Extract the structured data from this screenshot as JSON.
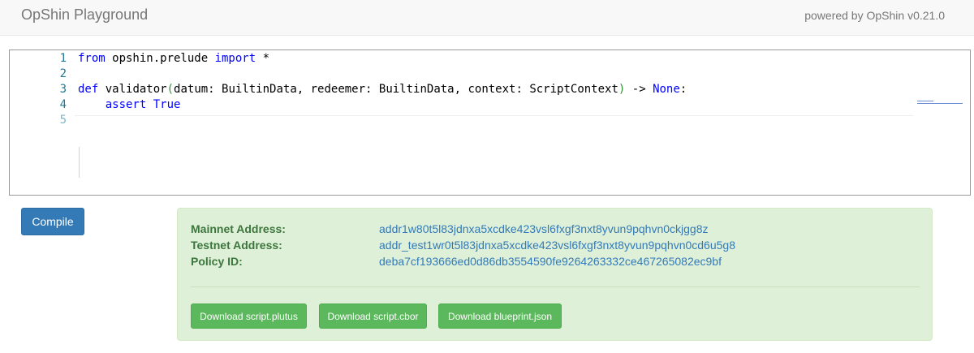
{
  "header": {
    "brand": "OpShin Playground",
    "powered_by": "powered by OpShin v0.21.0"
  },
  "editor": {
    "lines": [
      {
        "number": "1",
        "tokens": [
          {
            "t": "from",
            "k": "kw"
          },
          {
            "t": " opshin.prelude ",
            "k": ""
          },
          {
            "t": "import",
            "k": "kw"
          },
          {
            "t": " *",
            "k": ""
          }
        ]
      },
      {
        "number": "2",
        "tokens": []
      },
      {
        "number": "3",
        "tokens": [
          {
            "t": "def",
            "k": "kw"
          },
          {
            "t": " validator",
            "k": ""
          },
          {
            "t": "(",
            "k": "paren"
          },
          {
            "t": "datum: BuiltinData, redeemer: BuiltinData, context: ScriptContext",
            "k": ""
          },
          {
            "t": ")",
            "k": "paren"
          },
          {
            "t": " -> ",
            "k": ""
          },
          {
            "t": "None",
            "k": "kw"
          },
          {
            "t": ":",
            "k": ""
          }
        ]
      },
      {
        "number": "4",
        "tokens": [
          {
            "t": "    ",
            "k": ""
          },
          {
            "t": "assert",
            "k": "kw"
          },
          {
            "t": " ",
            "k": ""
          },
          {
            "t": "True",
            "k": "kw"
          }
        ]
      },
      {
        "number": "5",
        "tokens": []
      }
    ]
  },
  "compile_button": "Compile",
  "result": {
    "mainnet_label": "Mainnet Address:",
    "mainnet_value": "addr1w80t5l83jdnxa5xcdke423vsl6fxgf3nxt8yvun9pqhvn0ckjgg8z",
    "testnet_label": "Testnet Address:",
    "testnet_value": "addr_test1wr0t5l83jdnxa5xcdke423vsl6fxgf3nxt8yvun9pqhvn0cd6u5g8",
    "policy_label": "Policy ID:",
    "policy_value": "deba7cf193666ed0d86db3554590fe9264263332ce467265082ec9bf",
    "download_plutus": "Download script.plutus",
    "download_cbor": "Download script.cbor",
    "download_blueprint": "Download blueprint.json"
  },
  "colors": {
    "primary": "#337ab7",
    "success": "#5cb85c",
    "success_bg": "#dff0d8",
    "success_text": "#3c763d"
  }
}
